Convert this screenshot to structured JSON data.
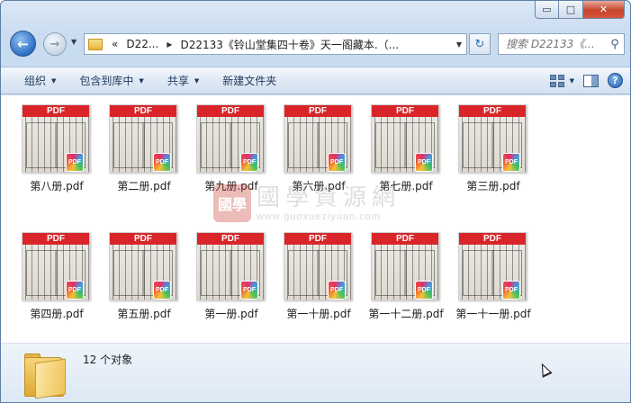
{
  "window": {
    "controls": {
      "minimize": "▭",
      "maximize": "□",
      "close": "✕"
    }
  },
  "nav": {
    "back_icon": "←",
    "forward_icon": "→",
    "dropdown_icon": "▼",
    "address": {
      "crumbs": [
        "«",
        "D22...",
        "D22133《铃山堂集四十卷》天一阁藏本.（..."
      ],
      "separator": "▶",
      "dropdown_icon": "▼"
    },
    "refresh_icon": "↻",
    "search": {
      "placeholder": "搜索 D22133《...",
      "icon": "search-icon"
    }
  },
  "toolbar": {
    "items": [
      {
        "label": "组织",
        "has_menu": true
      },
      {
        "label": "包含到库中",
        "has_menu": true
      },
      {
        "label": "共享",
        "has_menu": true
      },
      {
        "label": "新建文件夹",
        "has_menu": false
      }
    ],
    "help_label": "?"
  },
  "files": [
    {
      "name": "第八册.pdf"
    },
    {
      "name": "第二册.pdf"
    },
    {
      "name": "第九册.pdf"
    },
    {
      "name": "第六册.pdf"
    },
    {
      "name": "第七册.pdf"
    },
    {
      "name": "第三册.pdf"
    },
    {
      "name": "第四册.pdf"
    },
    {
      "name": "第五册.pdf"
    },
    {
      "name": "第一册.pdf"
    },
    {
      "name": "第一十册.pdf"
    },
    {
      "name": "第一十二册.pdf"
    },
    {
      "name": "第一十一册.pdf"
    }
  ],
  "thumbnail": {
    "banner": "PDF",
    "badge": "PDF",
    "banner_color": "#d9252a"
  },
  "watermark": {
    "seal": "國學",
    "title": "國學資源網",
    "url": "www.guoxueziyuan.com"
  },
  "status": {
    "text": "12 个对象"
  }
}
